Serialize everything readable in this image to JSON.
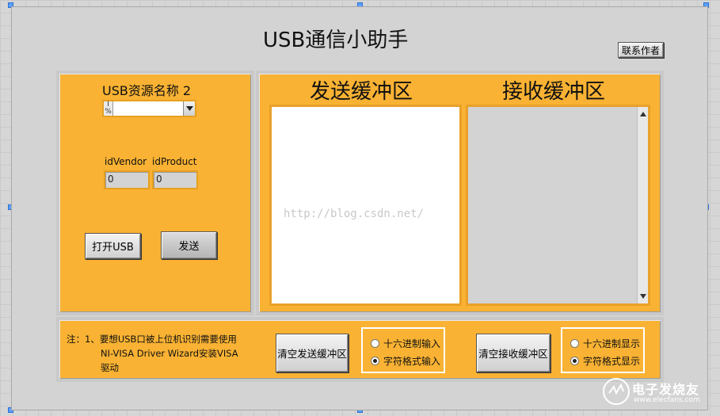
{
  "app": {
    "title": "USB通信小助手",
    "contact_button": "联系作者"
  },
  "left_panel": {
    "resource_label": "USB资源名称 2",
    "resource_value": "",
    "resource_prefix_icon": "visa-io-icon",
    "vendor_label": "idVendor",
    "product_label": "idProduct",
    "vendor_value": "0",
    "product_value": "0",
    "open_button": "打开USB",
    "send_button": "发送"
  },
  "buffers": {
    "send_title": "发送缓冲区",
    "receive_title": "接收缓冲区",
    "send_text": "",
    "receive_text": "",
    "watermark": "http://blog.csdn.net/"
  },
  "bottom": {
    "note_line1": "注：1、要想USB口被上位机识别需要使用",
    "note_line2": "NI-VISA Driver Wizard安装VISA",
    "note_line3": "驱动",
    "clear_send_button": "清空发送缓冲区",
    "clear_receive_button": "清空接收缓冲区",
    "send_mode_options": [
      "十六进制输入",
      "字符格式输入"
    ],
    "send_mode_selected": "字符格式输入",
    "receive_mode_options": [
      "十六进制显示",
      "字符格式显示"
    ],
    "receive_mode_selected": "字符格式显示"
  },
  "brand": {
    "logo_text": "电子发烧友",
    "logo_url_text": "www.elecfans.com"
  },
  "colors": {
    "panel_orange": "#f9b233",
    "front_panel_gray": "#d3d3d3",
    "selection_handle_blue": "#5aa0ff"
  }
}
